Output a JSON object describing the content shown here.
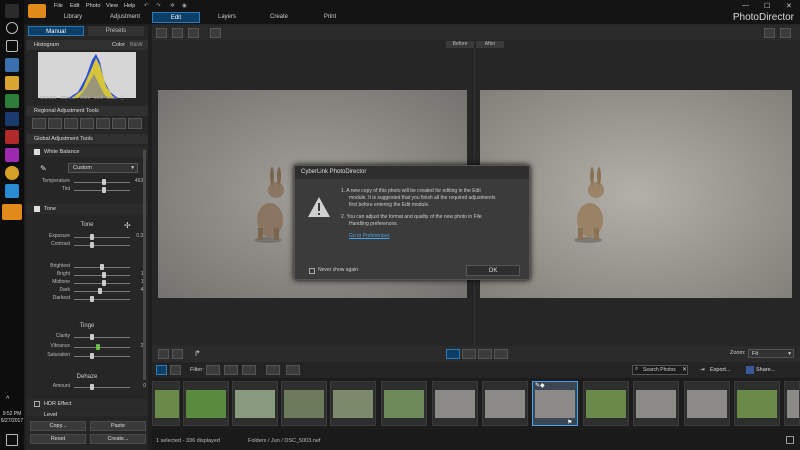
{
  "taskbar": {
    "time": "9:52 PM",
    "date": "6/27/2017"
  },
  "menubar": {
    "items": [
      "File",
      "Edit",
      "Photo",
      "View",
      "Help"
    ]
  },
  "modules": {
    "library": "Library",
    "adjustment": "Adjustment",
    "edit": "Edit",
    "layers": "Layers",
    "create": "Create",
    "print": "Print"
  },
  "app_name": "PhotoDirector",
  "panel": {
    "tab_manual": "Manual",
    "tab_presets": "Presets",
    "histogram": {
      "title": "Histogram",
      "color": "Color",
      "bw": "B&W",
      "iso": "ISO 200",
      "focal": "300 mm",
      "ev": "0 EV",
      "aperture": "f/5.6",
      "shutter": "1/320",
      "info": "ⓘ"
    },
    "regional_title": "Regional Adjustment Tools",
    "global_title": "Global Adjustment Tools",
    "white_balance": {
      "title": "White Balance",
      "preset": "Custom",
      "temperature_label": "Temperature",
      "temperature_value": "4632",
      "tint_label": "Tint",
      "tint_value": "3"
    },
    "tone": {
      "title": "Tone",
      "group": "Tone",
      "exposure_label": "Exposure",
      "exposure_value": "0.35",
      "contrast_label": "Contrast",
      "contrast_value": "0",
      "brightest_label": "Brightest",
      "brightest_value": "0",
      "bright_label": "Bright",
      "bright_value": "11",
      "midtone_label": "Midtone",
      "midtone_value": "11",
      "dark_label": "Dark",
      "dark_value": "41",
      "darkest_label": "Darkest",
      "darkest_value": "0"
    },
    "tinge": {
      "group": "Tinge",
      "clarity_label": "Clarity",
      "clarity_value": "0",
      "vibrance_label": "Vibrance",
      "vibrance_value": "26",
      "saturation_label": "Saturation",
      "saturation_value": "0"
    },
    "dehaze": {
      "group": "Dehaze",
      "amount_label": "Amount",
      "amount_value": "0"
    },
    "hdr_title": "HDR Effect",
    "level_title": "Level",
    "buttons": {
      "copy": "Copy...",
      "paste": "Paste",
      "reset": "Reset",
      "create": "Create..."
    }
  },
  "viewer": {
    "before": "Before",
    "after": "After"
  },
  "dialog": {
    "title": "CyberLink PhotoDirector",
    "item1_line1": "1.  A new copy of this photo will be created for editing in the Edit",
    "item1_line2": "module. It is suggested that you finish all the required adjustments",
    "item1_line3": "first before entering the Edit module.",
    "item2_line1": "2.  You can adjust the format and quality of the new photo in File",
    "item2_line2": "Handling preferences.",
    "link": "Go to Preferences",
    "checkbox_label": "Never show again",
    "ok": "OK"
  },
  "bottom": {
    "zoom_label": "Zoom:",
    "zoom_value": "Fit",
    "filter_label": "Filter:",
    "search_placeholder": "Search Photos",
    "export": "Export...",
    "share": "Share..."
  },
  "status": {
    "selection": "1 selected - 336 displayed",
    "path": "Folders / Jun / DSC_5003.nef"
  },
  "colors": {
    "accent": "#2c7ab8",
    "brand": "#e08a1a",
    "link": "#4aa3e8"
  }
}
